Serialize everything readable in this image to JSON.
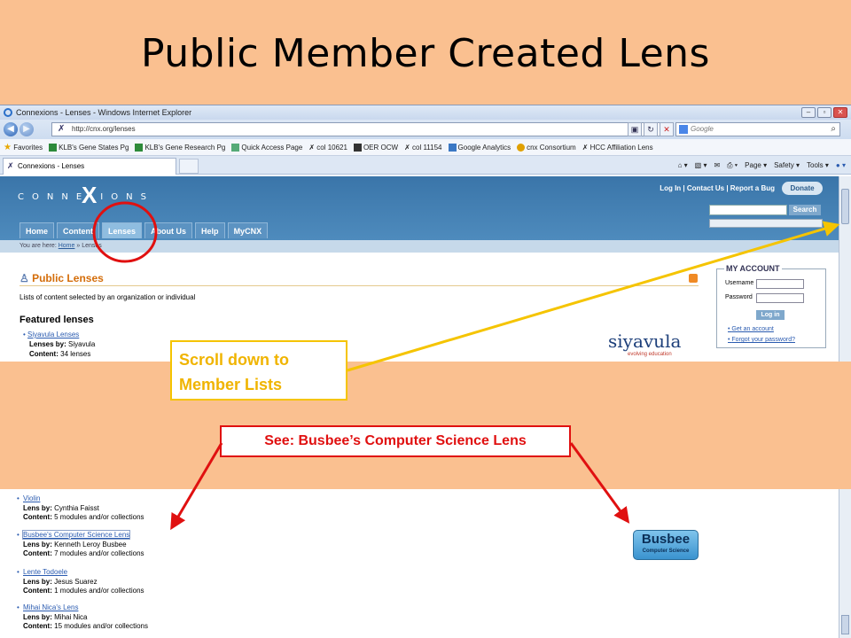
{
  "slide": {
    "title": "Public Member Created Lens"
  },
  "browser": {
    "window_title": "Connexions - Lenses - Windows Internet Explorer",
    "address": "http://cnx.org/lenses",
    "search_placeholder": "Google",
    "favorites_label": "Favorites",
    "favorites": [
      "KLB's Gene States Pg",
      "KLB's Gene Research Pg",
      "Quick Access Page",
      "col 10621",
      "OER OCW",
      "col 11154",
      "Google Analytics",
      "cnx Consortium",
      "HCC Affiliation Lens"
    ],
    "tab_title": "Connexions - Lenses",
    "command_bar": [
      "Page ▾",
      "Safety ▾",
      "Tools ▾"
    ]
  },
  "site": {
    "logo_text": "CONNE  IONS",
    "logo_mark": "X",
    "top_links": "Log In | Contact Us | Report a Bug",
    "donate_label": "Donate",
    "search_button": "Search",
    "nav_tabs": [
      "Home",
      "Content",
      "Lenses",
      "About Us",
      "Help",
      "MyCNX"
    ],
    "breadcrumb_prefix": "You are here:",
    "breadcrumb_home": "Home",
    "breadcrumb_current": "» Lenses"
  },
  "main": {
    "heading": "Public Lenses",
    "description": "Lists of content selected by an organization or individual",
    "featured_heading": "Featured lenses",
    "featured_item": {
      "name": "Siyavula Lenses",
      "by_label": "Lenses by:",
      "by": "Siyavula",
      "content_label": "Content:",
      "content": "34 lenses"
    },
    "siyavula_logo": "siyavula",
    "siyavula_tagline": "evolving education"
  },
  "account": {
    "title": "MY ACCOUNT",
    "username_label": "Username",
    "password_label": "Password",
    "login_button": "Log in",
    "get_account": "Get an account",
    "forgot": "Forgot your password?"
  },
  "member_lenses": [
    {
      "name": "Violin",
      "by": "Cynthia Faisst",
      "content": "5 modules and/or collections"
    },
    {
      "name": "Busbee's Computer Science Lens",
      "by": "Kenneth Leroy Busbee",
      "content": "7 modules and/or collections"
    },
    {
      "name": "Lente Todoele",
      "by": "Jesus Suarez",
      "content": "1 modules and/or collections"
    },
    {
      "name": "Mihai Nica's Lens",
      "by": "Mihai Nica",
      "content": "15 modules and/or collections"
    }
  ],
  "member_labels": {
    "by_label": "Lens by:",
    "content_label": "Content:"
  },
  "busbee_logo": {
    "main": "Busbee",
    "sub": "Computer Science"
  },
  "callouts": {
    "scroll": "Scroll down to Member Lists",
    "see": "See: Busbee’s Computer Science Lens"
  },
  "colors": {
    "slide_bg": "#FAC090",
    "yellow_callout": "#F5C400",
    "red_callout": "#E01010",
    "cnx_blue": "#3A75A9"
  }
}
